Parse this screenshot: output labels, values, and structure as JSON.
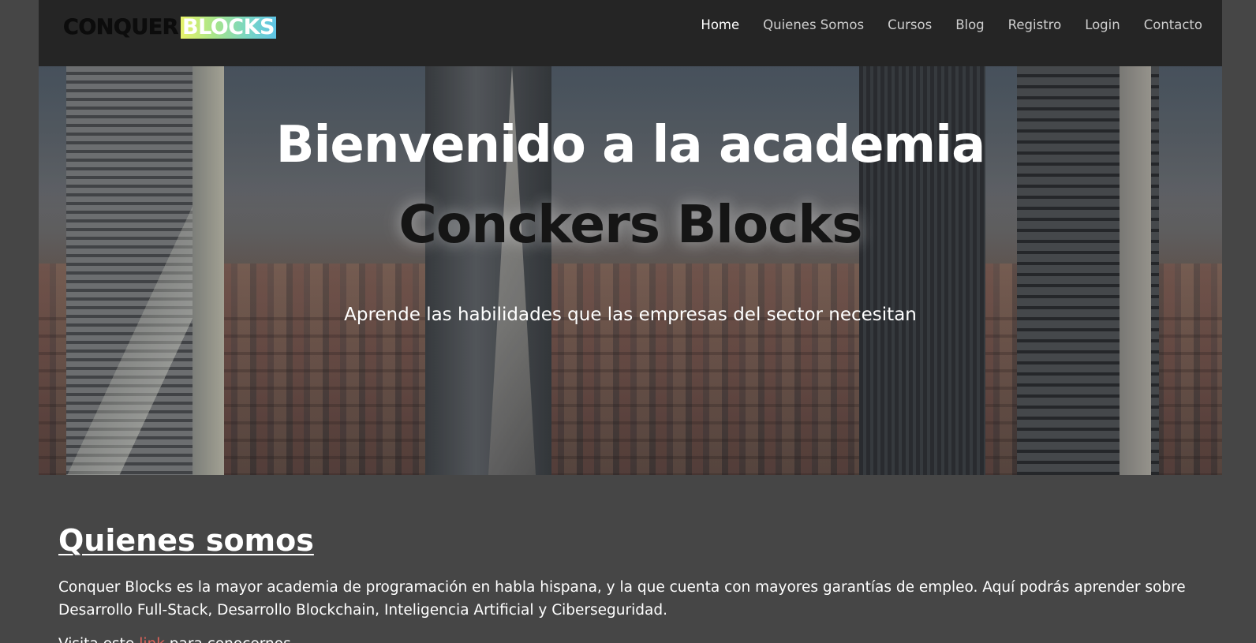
{
  "header": {
    "logo_left": "CONQUER",
    "logo_right": "BLOCKS",
    "nav": [
      {
        "label": "Home",
        "active": true
      },
      {
        "label": "Quienes Somos",
        "active": false
      },
      {
        "label": "Cursos",
        "active": false
      },
      {
        "label": "Blog",
        "active": false
      },
      {
        "label": "Registro",
        "active": false
      },
      {
        "label": "Login",
        "active": false
      },
      {
        "label": "Contacto",
        "active": false
      }
    ]
  },
  "hero": {
    "title": "Bienvenido a la academia",
    "brand": "Conckers Blocks",
    "subtitle": "Aprende las habilidades que las empresas del sector necesitan"
  },
  "about": {
    "title": "Quienes somos",
    "text": "Conquer Blocks es la mayor academia de programación en habla hispana, y la que cuenta con mayores garantías de empleo. Aquí podrás aprender sobre Desarrollo Full-Stack, Desarrollo Blockchain, Inteligencia Artificial y Ciberseguridad.",
    "visit_before": "Visita este ",
    "visit_link": "link",
    "visit_after": " para conocernos"
  },
  "colors": {
    "page_bg": "#464646",
    "navbar_bg": "#252525",
    "link": "#e0645b"
  }
}
